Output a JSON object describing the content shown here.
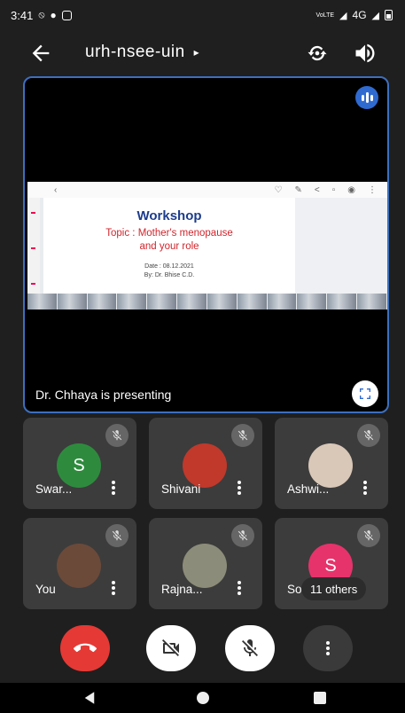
{
  "status_bar": {
    "time": "3:41",
    "network": "4G",
    "volte": "VoLTE"
  },
  "header": {
    "meeting_code": "urh-nsee-uin",
    "expand_glyph": "▸",
    "icons": [
      "back-arrow-icon",
      "switch-camera-icon",
      "speaker-icon"
    ]
  },
  "stage": {
    "presenting_text": "Dr. Chhaya is presenting",
    "slide": {
      "title": "Workshop",
      "topic_line1": "Topic : Mother's menopause",
      "topic_line2": "and your role",
      "date": "Date : 08.12.2021",
      "by": "By: Dr. Bhise C.D."
    }
  },
  "participants": [
    {
      "name": "Swar...",
      "avatar_letter": "S",
      "avatar_color": "#2e8b3e",
      "muted": true
    },
    {
      "name": "Shivani",
      "avatar_letter": "",
      "avatar_color": "#c0392b",
      "muted": true
    },
    {
      "name": "Ashwi...",
      "avatar_letter": "",
      "avatar_color": "#d9c7b8",
      "muted": true
    },
    {
      "name": "You",
      "avatar_letter": "",
      "avatar_color": "#6b4a3a",
      "muted": true
    },
    {
      "name": "Rajna...",
      "avatar_letter": "",
      "avatar_color": "#8c8c7a",
      "muted": true
    },
    {
      "name": "So",
      "avatar_letter": "S",
      "avatar_color": "#e6336b",
      "muted": true,
      "overflow_label": "11 others"
    }
  ],
  "controls": {
    "end_call_color": "#e53935",
    "items": [
      "end-call-icon",
      "camera-off-icon",
      "mic-off-icon",
      "more-options-icon"
    ]
  },
  "colors": {
    "background": "#1f1f1f",
    "tile": "#3c3c3c",
    "stage_border": "#3d6fbf"
  }
}
